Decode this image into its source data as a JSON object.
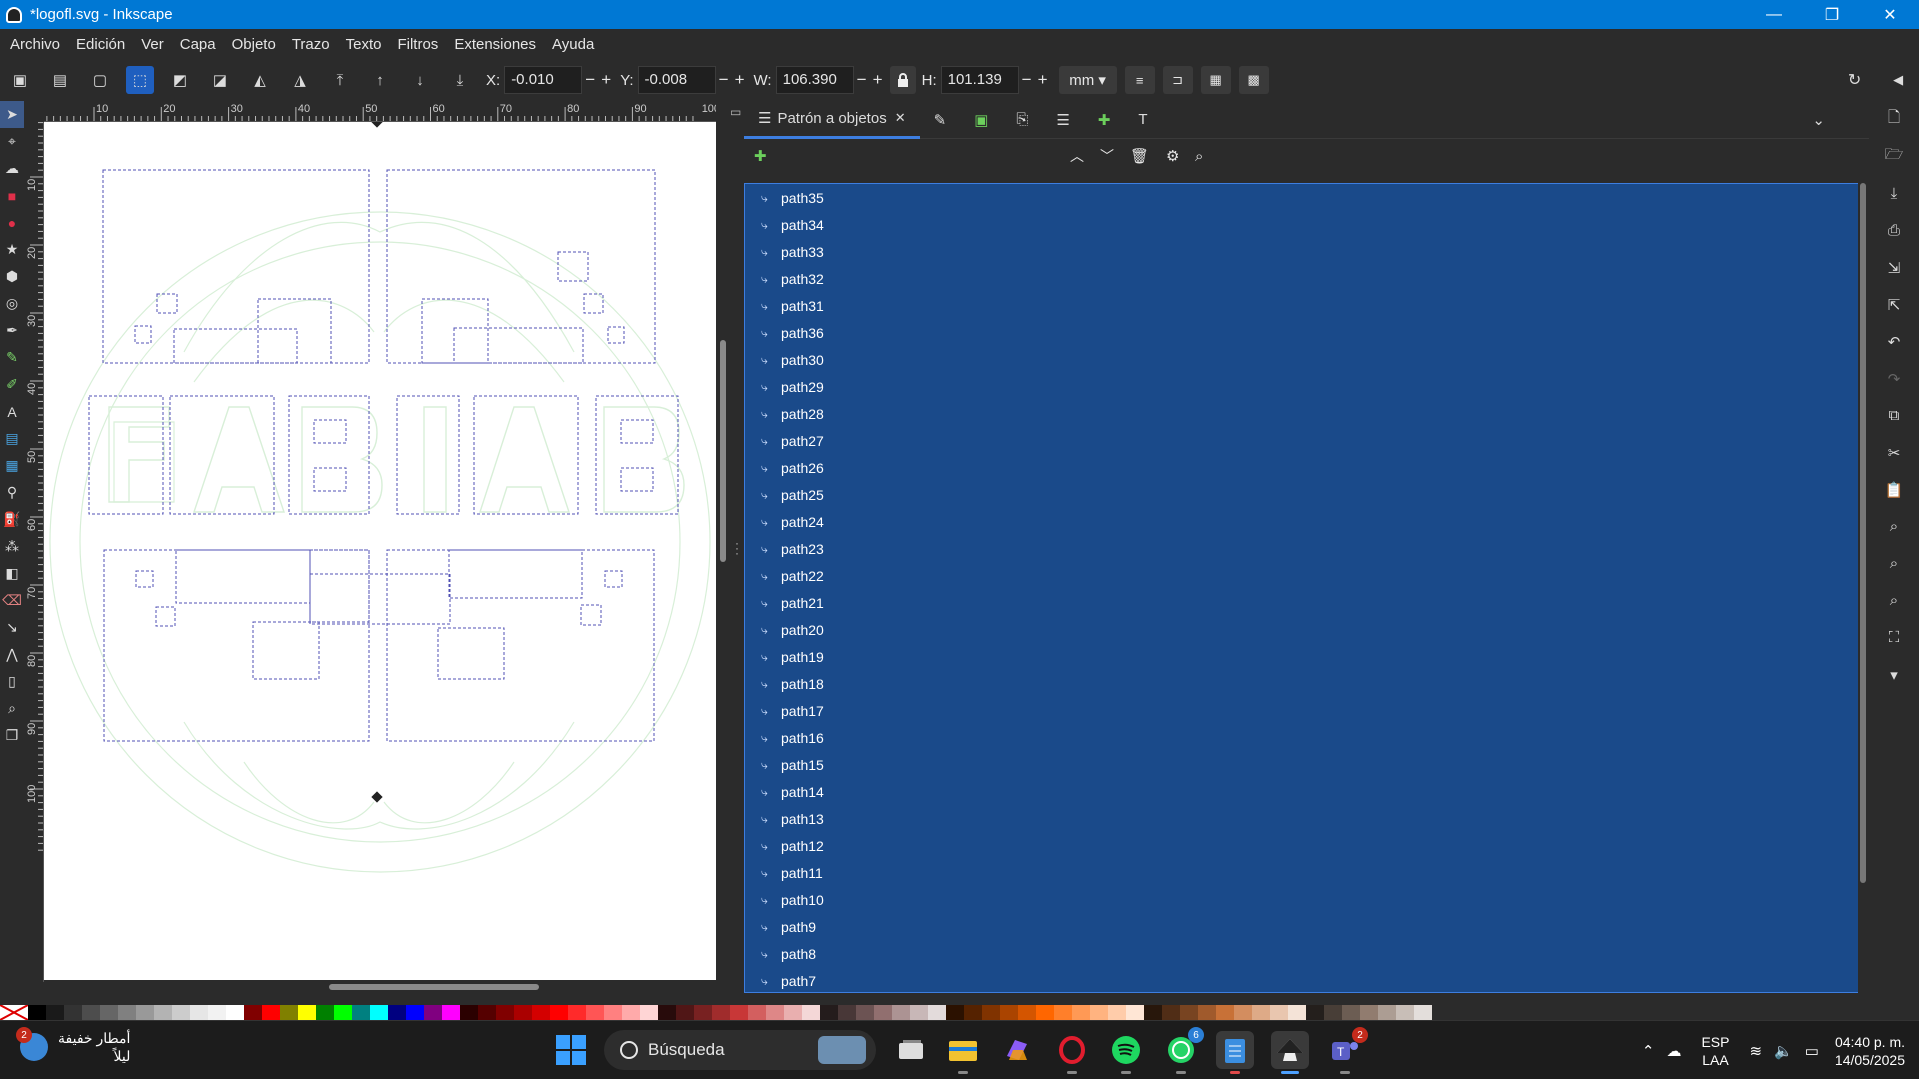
{
  "window": {
    "title": "*logofl.svg - Inkscape",
    "minimize": "—",
    "maximize": "❐",
    "close": "✕"
  },
  "menu": [
    "Archivo",
    "Edición",
    "Ver",
    "Capa",
    "Objeto",
    "Trazo",
    "Texto",
    "Filtros",
    "Extensiones",
    "Ayuda"
  ],
  "controls": {
    "x_label": "X:",
    "x_value": "-0.010",
    "y_label": "Y:",
    "y_value": "-0.008",
    "w_label": "W:",
    "w_value": "106.390",
    "h_label": "H:",
    "h_value": "101.139",
    "unit": "mm",
    "minus": "−",
    "plus": "+"
  },
  "ruler": {
    "top_ticks": [
      "10",
      "20",
      "30",
      "40",
      "50",
      "60",
      "70",
      "80",
      "90",
      "100"
    ],
    "left_ticks": [
      "10",
      "20",
      "30",
      "40",
      "50",
      "60",
      "70",
      "80",
      "90",
      "100"
    ]
  },
  "dock": {
    "active_tab": "Patrón a objetos",
    "tab_close": "✕",
    "objects": [
      "path35",
      "path34",
      "path33",
      "path32",
      "path31",
      "path36",
      "path30",
      "path29",
      "path28",
      "path27",
      "path26",
      "path25",
      "path24",
      "path23",
      "path22",
      "path21",
      "path20",
      "path19",
      "path18",
      "path17",
      "path16",
      "path15",
      "path14",
      "path13",
      "path12",
      "path11",
      "path10",
      "path9",
      "path8",
      "path7"
    ]
  },
  "taskbar": {
    "weather_text_line1": "أمطار خفيفة",
    "weather_text_line2": "ليلاً",
    "weather_badge": "2",
    "search_placeholder": "Búsqueda",
    "whatsapp_badge": "6",
    "teams_badge": "2",
    "lang_line1": "ESP",
    "lang_line2": "LAA",
    "time": "04:40 p. m.",
    "date": "14/05/2025"
  },
  "palette_colors": [
    "#000000",
    "#1a1a1a",
    "#333333",
    "#4d4d4d",
    "#666666",
    "#808080",
    "#999999",
    "#b3b3b3",
    "#cccccc",
    "#e6e6e6",
    "#f2f2f2",
    "#ffffff",
    "#800000",
    "#ff0000",
    "#808000",
    "#ffff00",
    "#008000",
    "#00ff00",
    "#008080",
    "#00ffff",
    "#000080",
    "#0000ff",
    "#800080",
    "#ff00ff",
    "#2b0000",
    "#550000",
    "#800000",
    "#aa0000",
    "#d40000",
    "#ff0000",
    "#ff2a2a",
    "#ff5555",
    "#ff8080",
    "#ffaaaa",
    "#ffd5d5",
    "#280b0b",
    "#501616",
    "#782121",
    "#a02c2c",
    "#c83737",
    "#d35f5f",
    "#de8787",
    "#e9afaf",
    "#f4d7d7",
    "#241c1c",
    "#483737",
    "#6c5353",
    "#916f6f",
    "#ac9393",
    "#c8b7b7",
    "#e3dbdb",
    "#2b1100",
    "#552200",
    "#803300",
    "#aa4400",
    "#d45500",
    "#ff6600",
    "#ff7f2a",
    "#ff9955",
    "#ffb380",
    "#ffccaa",
    "#ffe6d5",
    "#28170b",
    "#502d16",
    "#784421",
    "#a05a2c",
    "#c87137",
    "#d38d5f",
    "#deaa87",
    "#e9c6af",
    "#f4e3d7",
    "#241f1c",
    "#483e37",
    "#6c5d53",
    "#917c6f",
    "#ac9d93",
    "#c8beb7",
    "#e3dedb"
  ]
}
